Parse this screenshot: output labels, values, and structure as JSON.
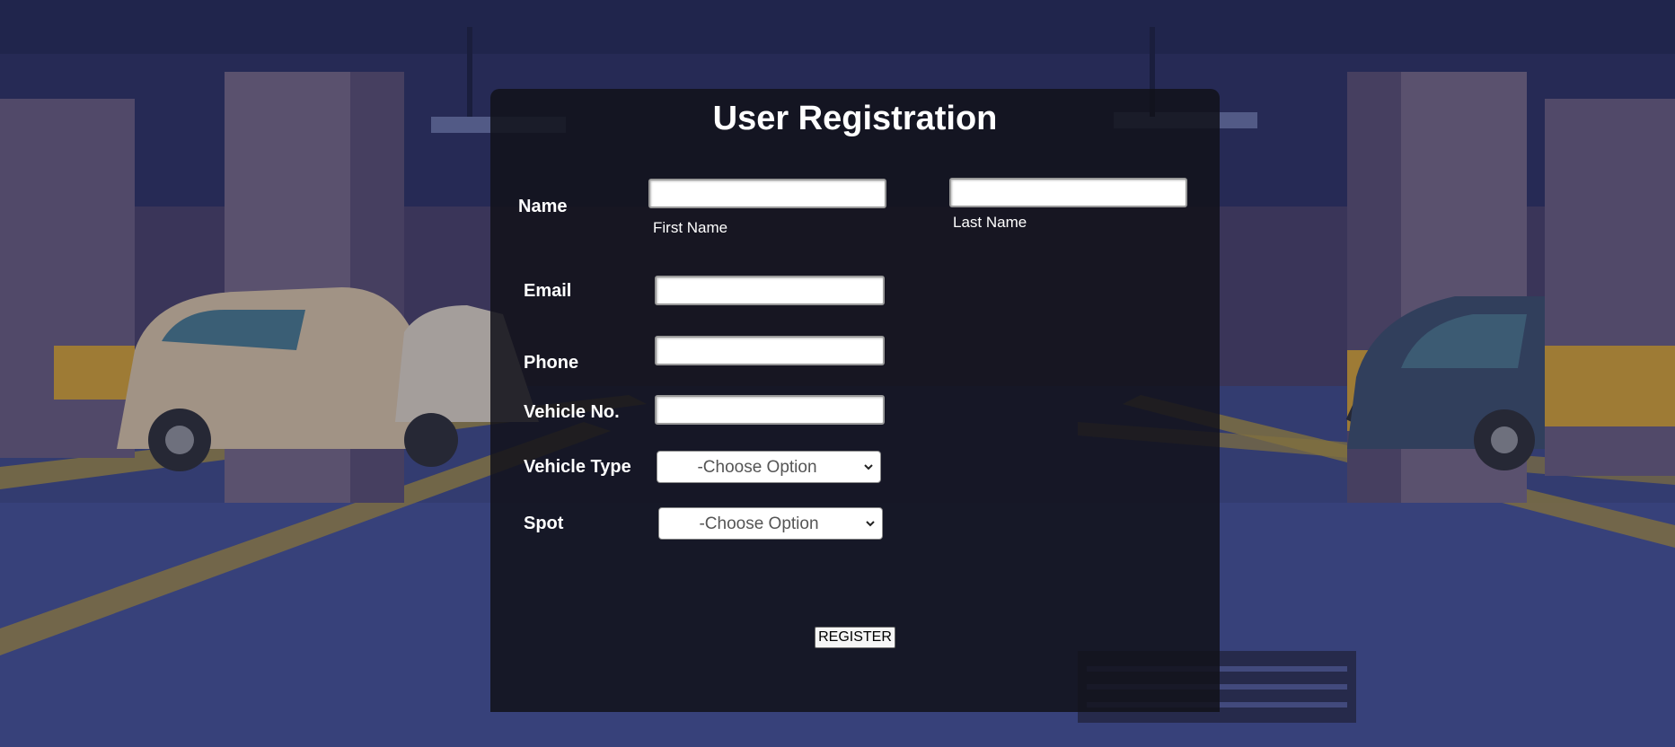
{
  "form": {
    "title": "User Registration",
    "name_label": "Name",
    "first_name": {
      "value": "",
      "caption": "First Name"
    },
    "last_name": {
      "value": "",
      "caption": "Last Name"
    },
    "email_label": "Email",
    "email_value": "",
    "phone_label": "Phone",
    "phone_value": "",
    "vehicle_no_label": "Vehicle No.",
    "vehicle_no_value": "",
    "vehicle_type_label": "Vehicle Type",
    "vehicle_type_selected": "-Choose Option",
    "spot_label": "Spot",
    "spot_selected": "-Choose Option",
    "register_label": "REGISTER"
  },
  "colors": {
    "panel": "#12121a",
    "text": "#ffffff",
    "background_scene": "#2a3262",
    "stripe_yellow": "#e7b22a"
  }
}
